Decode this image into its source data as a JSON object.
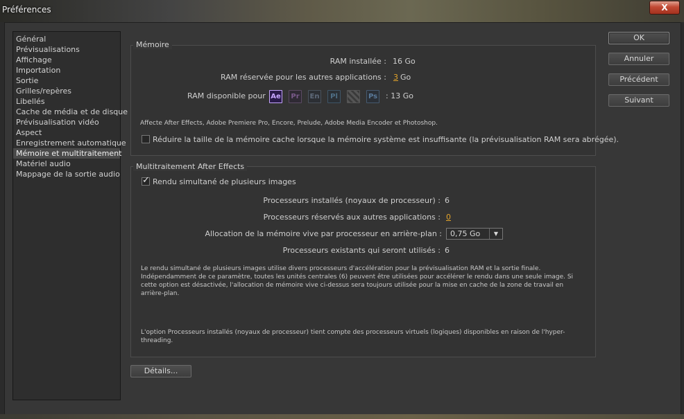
{
  "window": {
    "title": "Préférences",
    "close_label": "X"
  },
  "sidebar": {
    "items": [
      {
        "label": "Général"
      },
      {
        "label": "Prévisualisations"
      },
      {
        "label": "Affichage"
      },
      {
        "label": "Importation"
      },
      {
        "label": "Sortie"
      },
      {
        "label": "Grilles/repères"
      },
      {
        "label": "Libellés"
      },
      {
        "label": "Cache de média et de disque"
      },
      {
        "label": "Prévisualisation vidéo"
      },
      {
        "label": "Aspect"
      },
      {
        "label": "Enregistrement automatique"
      },
      {
        "label": "Mémoire et multitraitement"
      },
      {
        "label": "Matériel audio"
      },
      {
        "label": "Mappage de la sortie audio"
      }
    ],
    "selected": "Mémoire et multitraitement"
  },
  "memory": {
    "title": "Mémoire",
    "ram_installed_label": "RAM installée :",
    "ram_installed_value": "16 Go",
    "ram_reserved_label": "RAM réservée pour les autres applications :",
    "ram_reserved_value": "3",
    "ram_reserved_unit": "Go",
    "ram_available_label": "RAM disponible pour",
    "ram_available_value": ": 13 Go",
    "apps": [
      {
        "abbr": "Ae",
        "icon": "after-effects-icon",
        "color": "#b18cff",
        "bg": "#2a1a4a"
      },
      {
        "abbr": "Pr",
        "icon": "premiere-pro-icon",
        "color": "#7a5a8a",
        "bg": "#2f2a34"
      },
      {
        "abbr": "En",
        "icon": "encore-icon",
        "color": "#5f6a7a",
        "bg": "#2c2f34"
      },
      {
        "abbr": "Pl",
        "icon": "prelude-icon",
        "color": "#4f6f86",
        "bg": "#2b3035"
      },
      {
        "abbr": "",
        "icon": "media-encoder-icon",
        "color": "#777",
        "bg": "#3a3a3a"
      },
      {
        "abbr": "Ps",
        "icon": "photoshop-icon",
        "color": "#5a7a9a",
        "bg": "#2b3037"
      }
    ],
    "affects_note": "Affecte After Effects, Adobe Premiere Pro, Encore, Prelude, Adobe Media Encoder et Photoshop.",
    "reduce_cache_label": "Réduire la taille de la mémoire cache lorsque la mémoire système est insuffisante (la prévisualisation RAM sera abrégée).",
    "reduce_cache_checked": false
  },
  "multiprocessing": {
    "title": "Multitraitement After Effects",
    "render_multiple_label": "Rendu simultané de plusieurs images",
    "render_multiple_checked": true,
    "cpus_installed_label": "Processeurs installés (noyaux de processeur) :",
    "cpus_installed_value": "6",
    "cpus_reserved_label": "Processeurs réservés aux autres applications :",
    "cpus_reserved_value": "0",
    "ram_per_cpu_label": "Allocation de la mémoire vive par processeur en arrière-plan :",
    "ram_per_cpu_value": "0,75 Go",
    "cpus_used_label": "Processeurs existants qui seront utilisés :",
    "cpus_used_value": "6",
    "note1_line1": "Le rendu simultané de plusieurs images utilise divers processeurs d'accélération pour la prévisualisation RAM et la sortie finale.",
    "note1_line2": "Indépendamment de ce paramètre, toutes les unités centrales (6) peuvent être utilisées pour accélérer le rendu dans une seule image. Si",
    "note1_line3": "cette option est désactivée, l'allocation de mémoire vive ci-dessus sera toujours utilisée pour la mise en cache de la zone de travail en",
    "note1_line4": "arrière-plan.",
    "note2_line1": "L'option Processeurs installés (noyaux de processeur) tient compte des processeurs virtuels (logiques) disponibles en raison de l'hyper-",
    "note2_line2": "threading."
  },
  "buttons": {
    "ok": "OK",
    "cancel": "Annuler",
    "previous": "Précédent",
    "next": "Suivant",
    "details": "Détails..."
  }
}
